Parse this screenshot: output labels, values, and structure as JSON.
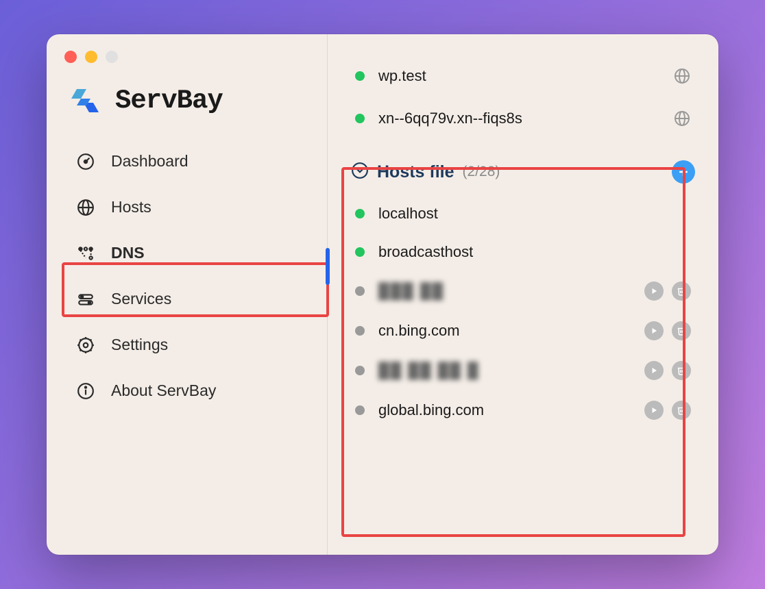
{
  "app": {
    "title": "ServBay"
  },
  "nav": {
    "items": [
      {
        "label": "Dashboard",
        "icon": "dashboard"
      },
      {
        "label": "Hosts",
        "icon": "hosts"
      },
      {
        "label": "DNS",
        "icon": "dns",
        "active": true
      },
      {
        "label": "Services",
        "icon": "services"
      },
      {
        "label": "Settings",
        "icon": "settings"
      },
      {
        "label": "About ServBay",
        "icon": "about"
      }
    ]
  },
  "content": {
    "top_hosts": [
      {
        "name": "wp.test",
        "status": "green",
        "link": true
      },
      {
        "name": "xn--6qq79v.xn--fiqs8s",
        "status": "green",
        "link": true
      }
    ],
    "section": {
      "title": "Hosts file",
      "count": "(2/28)"
    },
    "hosts": [
      {
        "name": "localhost",
        "status": "green",
        "actions": false
      },
      {
        "name": "broadcasthost",
        "status": "green",
        "actions": false
      },
      {
        "name": "███ ██",
        "status": "gray",
        "actions": true,
        "blurred": true
      },
      {
        "name": "cn.bing.com",
        "status": "gray",
        "actions": true
      },
      {
        "name": "██ ██ ██ █",
        "status": "gray",
        "actions": true,
        "blurred": true
      },
      {
        "name": "global.bing.com",
        "status": "gray",
        "actions": true
      }
    ]
  }
}
